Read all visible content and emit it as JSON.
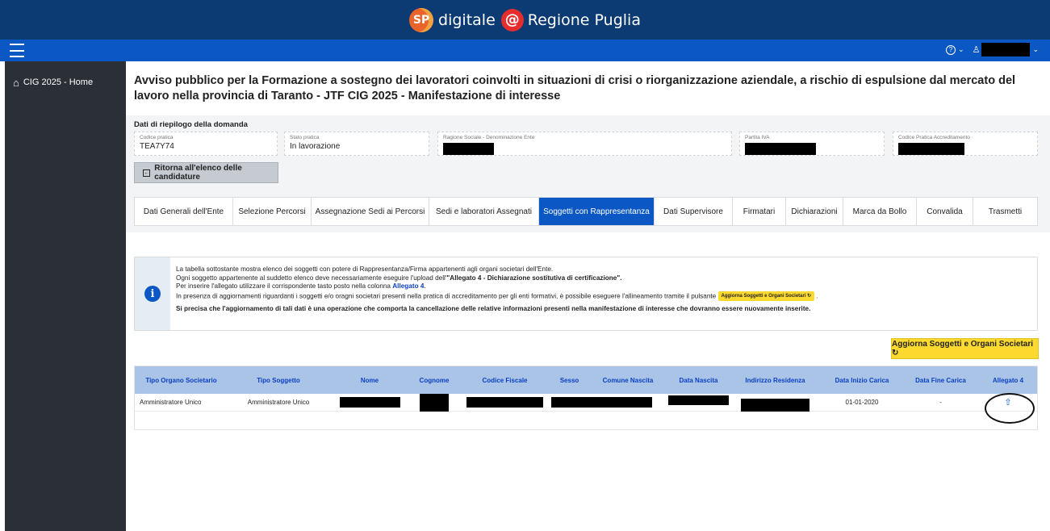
{
  "header": {
    "brand_sp": "SP",
    "brand_left": "digitale",
    "brand_at": "@",
    "brand_right": "Regione Puglia"
  },
  "navbar": {
    "help_icon": "?",
    "chevron": "⌄",
    "user_icon": "♙"
  },
  "sidebar": {
    "items": [
      {
        "icon": "home-icon",
        "label": "CIG 2025 - Home"
      }
    ]
  },
  "page": {
    "title": "Avviso pubblico per la Formazione a sostegno dei lavoratori coinvolti in situazioni di crisi o riorganizzazione aziendale, a rischio di espulsione dal mercato del lavoro nella provincia di Taranto - JTF CIG 2025 - Manifestazione di interesse"
  },
  "summary": {
    "title": "Dati di riepilogo della domanda",
    "fields": [
      {
        "label": "Codice pratica",
        "value": "TEA7Y74"
      },
      {
        "label": "Stato pratica",
        "value": "In lavorazione"
      },
      {
        "label": "Ragione Sociale - Denominazione Ente",
        "value": ""
      },
      {
        "label": "Partita IVA",
        "value": ""
      },
      {
        "label": "Codice Pratica Accreditamento",
        "value": ""
      }
    ],
    "back_button": "Ritorna all'elenco delle candidature"
  },
  "tabs": [
    {
      "label": "Dati Generali dell'Ente"
    },
    {
      "label": "Selezione Percorsi"
    },
    {
      "label": "Assegnazione Sedi ai Percorsi"
    },
    {
      "label": "Sedi e laboratori Assegnati"
    },
    {
      "label": "Soggetti con Rappresentanza",
      "active": true
    },
    {
      "label": "Dati Supervisore"
    },
    {
      "label": "Firmatari"
    },
    {
      "label": "Dichiarazioni"
    },
    {
      "label": "Marca da Bollo"
    },
    {
      "label": "Convalida"
    },
    {
      "label": "Trasmetti"
    }
  ],
  "info": {
    "icon": "i",
    "line1": "La tabella sottostante mostra elenco dei soggetti con potere di Rappresentanza/Firma appartenenti agli organi societari dell'Ente.",
    "line2_pre": "Ogni soggetto appartenente al suddetto elenco deve necessariamente eseguire l'upload dell'",
    "line2_bold": "\"Allegato 4 - Dichiarazione sostitutiva di certificazione\".",
    "line3_pre": "Per inserire l'allegato utilizzare il corrispondente tasto posto nella colonna ",
    "line3_link": "Allegato 4",
    "line3_post": ".",
    "line4_pre": "In presenza di aggiornamenti riguardanti i soggetti e/o oragni societari presenti nella pratica di accreditamento per gli enti formativi, è possibile eseguere l'allineamento tramite il pulsante",
    "line4_chip": "Aggiorna Soggetti e Organi Societari ↻",
    "line4_post": ".",
    "line5": "Si precisa che l'aggiornamento di tali dati è una operazione che comporta la cancellazione delle relative informazioni presenti nella manifestazione di interesse che dovranno essere nuovamente inserite."
  },
  "update_button": "Aggiorna Soggetti e Organi Societari ↻",
  "table": {
    "columns": [
      "Tipo Organo Societario",
      "Tipo Soggetto",
      "Nome",
      "Cognome",
      "Codice Fiscale",
      "Sesso",
      "Comune Nascita",
      "Data Nascita",
      "Indirizzo Residenza",
      "Data Inizio Carica",
      "Data Fine Carica",
      "Allegato 4"
    ],
    "rows": [
      {
        "tipo_organo": "Amministratore Unico",
        "tipo_soggetto": "Amministratore Unico",
        "data_inizio": "01-01-2020",
        "data_fine": "-",
        "upload_icon": "upload-icon"
      }
    ]
  },
  "colors": {
    "topbar": "#0c3b73",
    "navbar": "#0b57c4",
    "sidebar": "#2a3036",
    "accent_yellow": "#fcd92e",
    "table_header": "#a9c4e6"
  }
}
